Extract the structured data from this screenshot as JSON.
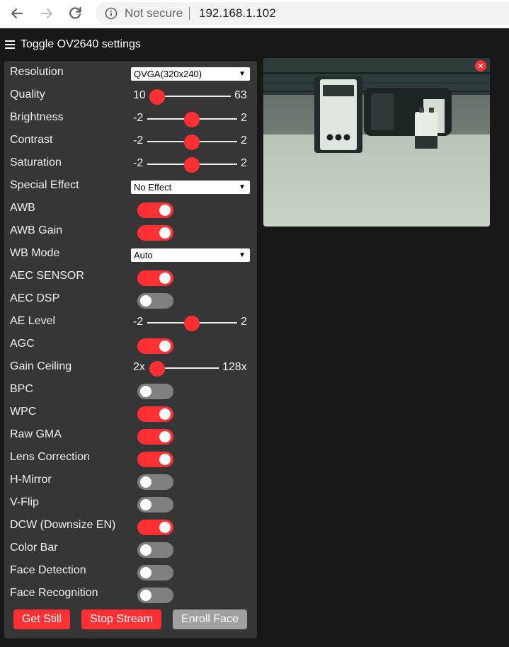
{
  "browser": {
    "security_label": "Not secure",
    "url": "192.168.1.102"
  },
  "header": {
    "toggle_label": "Toggle OV2640 settings"
  },
  "controls": {
    "resolution": {
      "label": "Resolution",
      "selected": "QVGA(320x240)"
    },
    "quality": {
      "label": "Quality",
      "min": "10",
      "max": "63",
      "value": 10
    },
    "brightness": {
      "label": "Brightness",
      "min": "-2",
      "max": "2",
      "value": 0
    },
    "contrast": {
      "label": "Contrast",
      "min": "-2",
      "max": "2",
      "value": 0
    },
    "saturation": {
      "label": "Saturation",
      "min": "-2",
      "max": "2",
      "value": 0
    },
    "special_effect": {
      "label": "Special Effect",
      "selected": "No Effect"
    },
    "awb": {
      "label": "AWB",
      "on": true
    },
    "awb_gain": {
      "label": "AWB Gain",
      "on": true
    },
    "wb_mode": {
      "label": "WB Mode",
      "selected": "Auto"
    },
    "aec_sensor": {
      "label": "AEC SENSOR",
      "on": true
    },
    "aec_dsp": {
      "label": "AEC DSP",
      "on": false
    },
    "ae_level": {
      "label": "AE Level",
      "min": "-2",
      "max": "2",
      "value": 0
    },
    "agc": {
      "label": "AGC",
      "on": true
    },
    "gain_ceiling": {
      "label": "Gain Ceiling",
      "min": "2x",
      "max": "128x",
      "value": 0
    },
    "bpc": {
      "label": "BPC",
      "on": false
    },
    "wpc": {
      "label": "WPC",
      "on": true
    },
    "raw_gma": {
      "label": "Raw GMA",
      "on": true
    },
    "lens_correction": {
      "label": "Lens Correction",
      "on": true
    },
    "h_mirror": {
      "label": "H-Mirror",
      "on": false
    },
    "v_flip": {
      "label": "V-Flip",
      "on": false
    },
    "dcw": {
      "label": "DCW (Downsize EN)",
      "on": true
    },
    "color_bar": {
      "label": "Color Bar",
      "on": false
    },
    "face_detection": {
      "label": "Face Detection",
      "on": false
    },
    "face_recognition": {
      "label": "Face Recognition",
      "on": false
    }
  },
  "buttons": {
    "get_still": "Get Still",
    "stop_stream": "Stop Stream",
    "enroll_face": "Enroll Face"
  },
  "stream": {
    "close_label": "×"
  },
  "colors": {
    "accent": "#ff3034",
    "panel": "#363636",
    "background": "#181818",
    "switch_off": "#808080",
    "disabled_button": "#a0a0a0"
  }
}
